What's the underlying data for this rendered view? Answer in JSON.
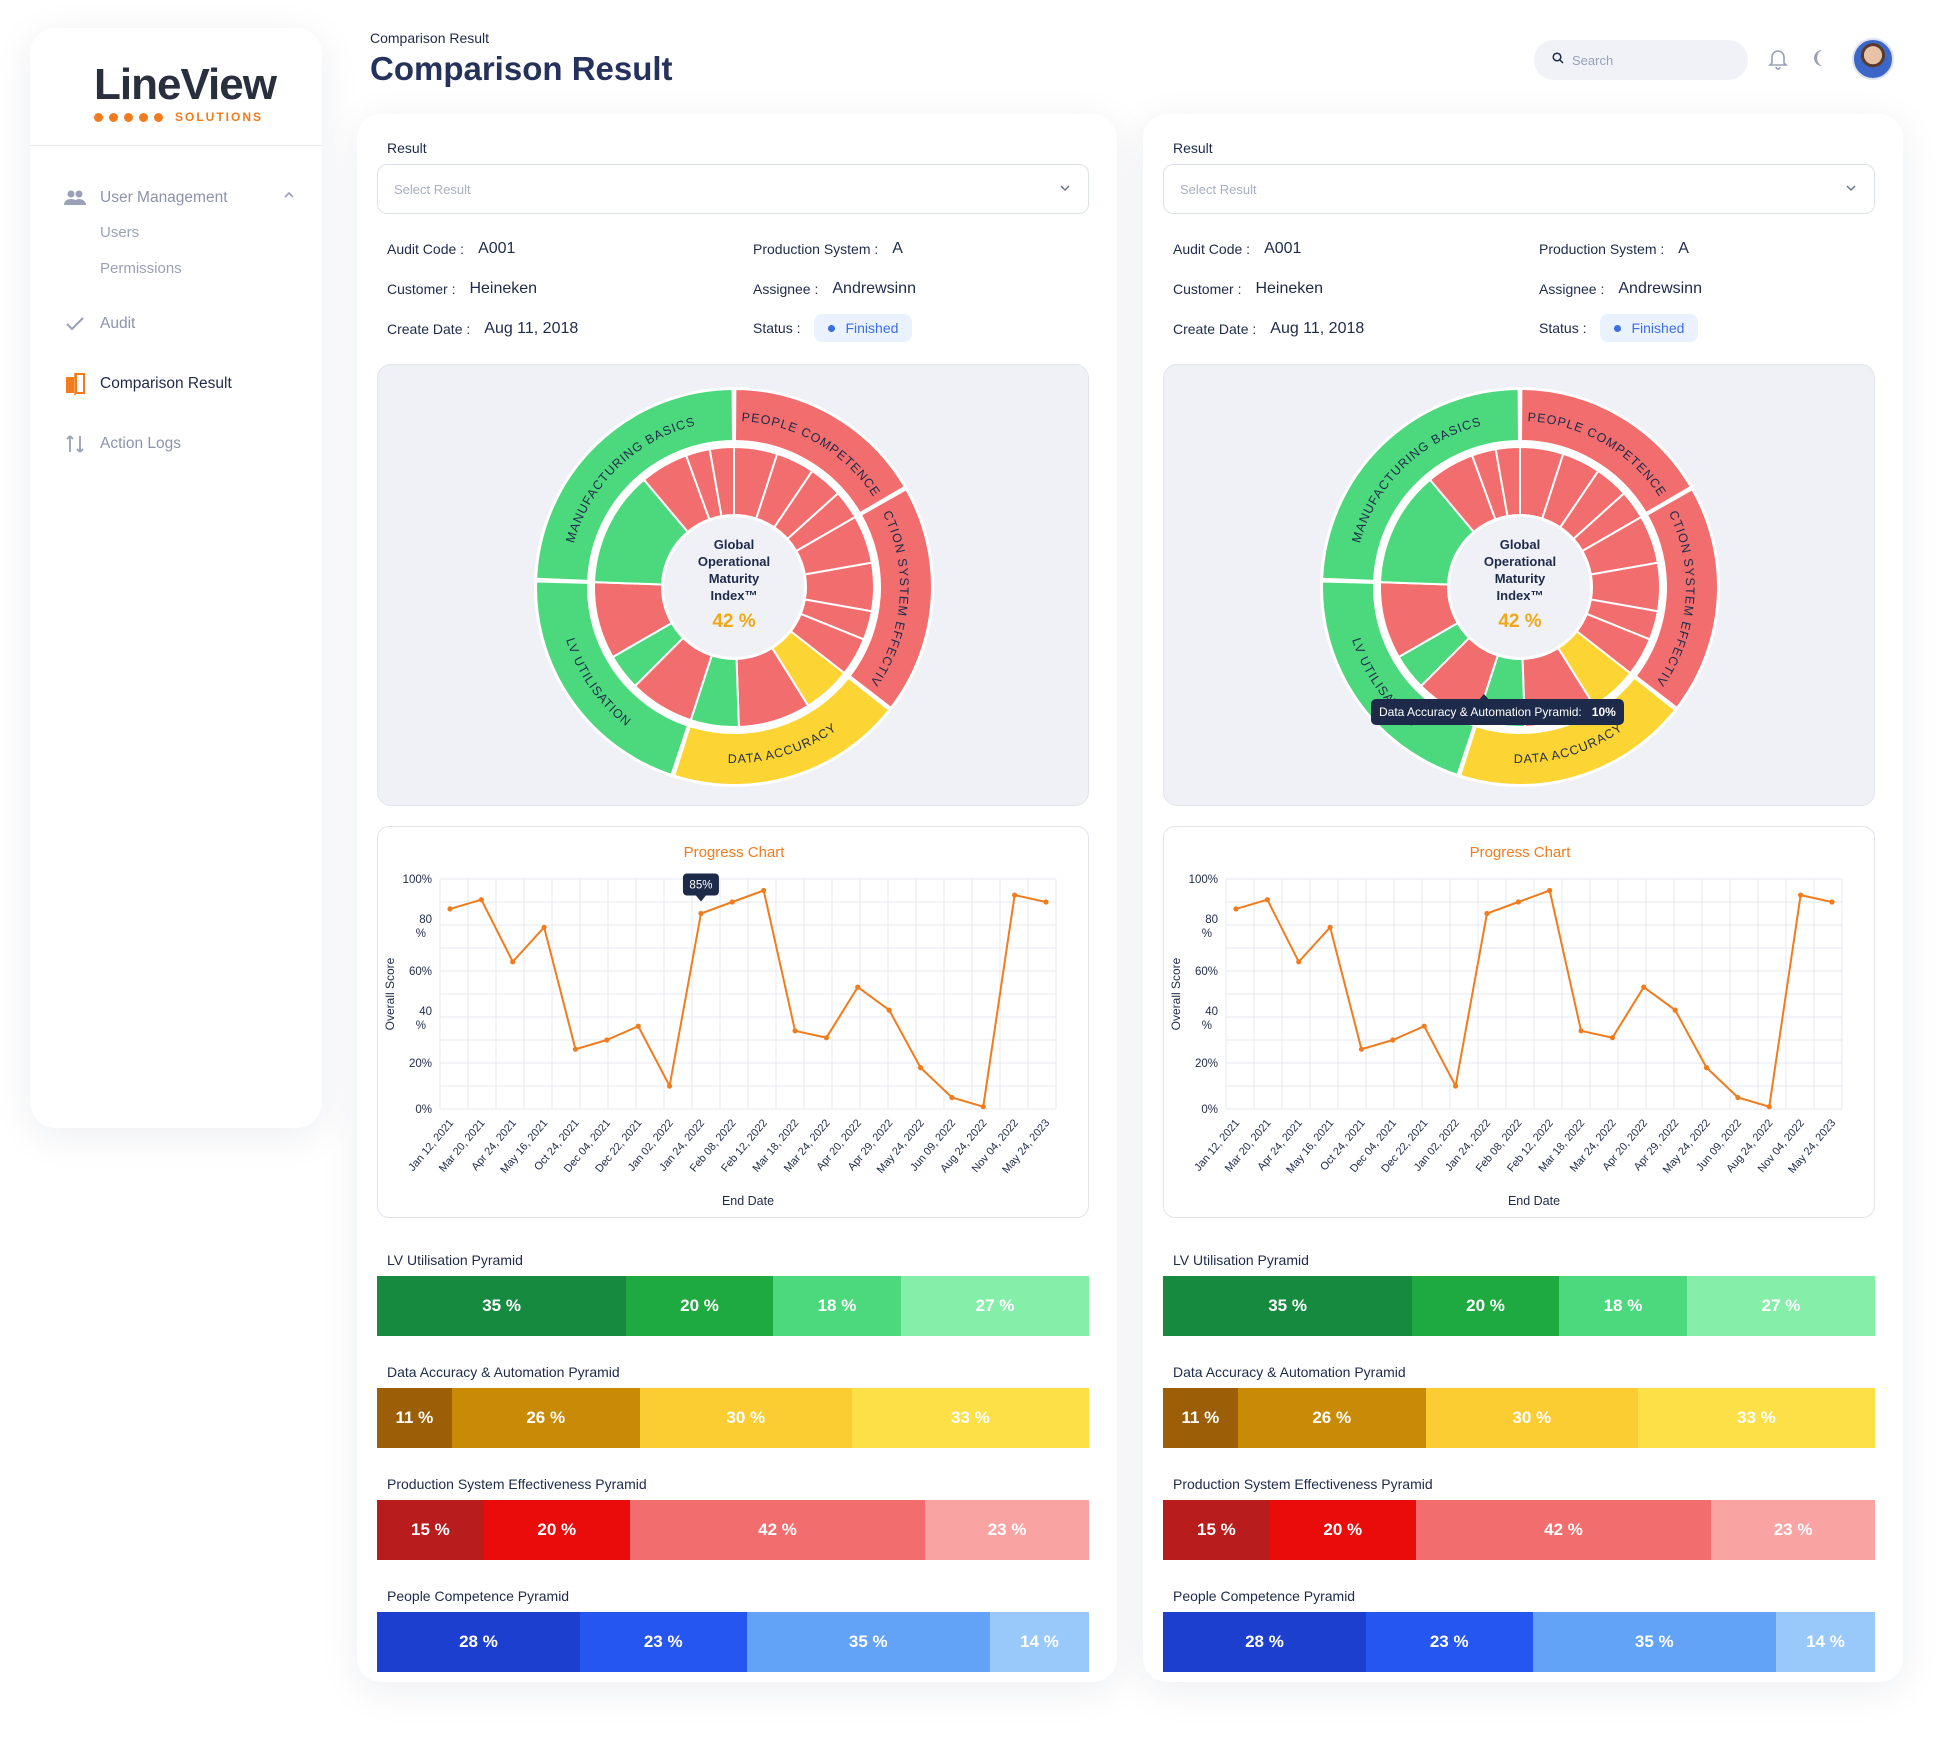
{
  "app": {
    "logo_word": "LineView",
    "logo_sub": "SOLUTIONS"
  },
  "sidebar": {
    "user_management": "User Management",
    "users": "Users",
    "permissions": "Permissions",
    "audit": "Audit",
    "comparison_result": "Comparison Result",
    "action_logs": "Action Logs"
  },
  "header": {
    "breadcrumb": "Comparison Result",
    "title": "Comparison Result",
    "search_placeholder": "Search"
  },
  "panels": [
    {
      "result_label": "Result",
      "select_placeholder": "Select Result",
      "audit_code_label": "Audit Code :",
      "audit_code": "A001",
      "production_system_label": "Production System :",
      "production_system": "A",
      "customer_label": "Customer :",
      "customer": "Heineken",
      "assignee_label": "Assignee :",
      "assignee": "Andrewsinn",
      "create_date_label": "Create Date :",
      "create_date": "Aug 11, 2018",
      "status_label": "Status :",
      "status": "Finished",
      "tooltip": null
    },
    {
      "result_label": "Result",
      "select_placeholder": "Select Result",
      "audit_code_label": "Audit Code :",
      "audit_code": "A001",
      "production_system_label": "Production System :",
      "production_system": "A",
      "customer_label": "Customer :",
      "customer": "Heineken",
      "assignee_label": "Assignee :",
      "assignee": "Andrewsinn",
      "create_date_label": "Create Date :",
      "create_date": "Aug 11, 2018",
      "status_label": "Status :",
      "status": "Finished",
      "tooltip": {
        "label": "Data Accuracy & Automation Pyramid:",
        "value": "10%"
      }
    }
  ],
  "sunburst": {
    "center_lines": [
      "Global",
      "Operational",
      "Maturity",
      "Index™"
    ],
    "center_value": "42 %",
    "outer": [
      {
        "name": "PEOPLE COMPETENCE",
        "color": "#f26d6d",
        "start": 0,
        "end": 60
      },
      {
        "name": "PRODUCTION SYSTEM EFFECTIVENESS",
        "color": "#f26d6d",
        "start": 60,
        "end": 128
      },
      {
        "name": "DATA ACCURACY",
        "color": "#fcd535",
        "start": 128,
        "end": 198
      },
      {
        "name": "LV UTILISATION",
        "color": "#4cd87c",
        "start": 198,
        "end": 272
      },
      {
        "name": "MANUFACTURING BASICS",
        "color": "#4cd87c",
        "start": 272,
        "end": 360
      }
    ],
    "inner": [
      {
        "color": "#f26d6d",
        "start": 0,
        "end": 18
      },
      {
        "color": "#f26d6d",
        "start": 18,
        "end": 34
      },
      {
        "color": "#f26d6d",
        "start": 34,
        "end": 48
      },
      {
        "color": "#f26d6d",
        "start": 48,
        "end": 60
      },
      {
        "color": "#f26d6d",
        "start": 60,
        "end": 80
      },
      {
        "color": "#f26d6d",
        "start": 80,
        "end": 100
      },
      {
        "color": "#f26d6d",
        "start": 100,
        "end": 112
      },
      {
        "color": "#f26d6d",
        "start": 112,
        "end": 128
      },
      {
        "color": "#fcd535",
        "start": 128,
        "end": 148
      },
      {
        "color": "#f26d6d",
        "start": 148,
        "end": 178
      },
      {
        "color": "#4cd87c",
        "start": 178,
        "end": 198
      },
      {
        "color": "#f26d6d",
        "start": 198,
        "end": 225
      },
      {
        "color": "#4cd87c",
        "start": 225,
        "end": 240
      },
      {
        "color": "#f26d6d",
        "start": 240,
        "end": 272
      },
      {
        "color": "#4cd87c",
        "start": 272,
        "end": 320
      },
      {
        "color": "#f26d6d",
        "start": 320,
        "end": 340
      },
      {
        "color": "#f26d6d",
        "start": 340,
        "end": 350
      },
      {
        "color": "#f26d6d",
        "start": 350,
        "end": 360
      }
    ]
  },
  "chart_data": {
    "type": "line",
    "title": "Progress Chart",
    "xlabel": "End Date",
    "ylabel": "Overall Score",
    "ylim": [
      0,
      100
    ],
    "y_ticks": [
      "0%",
      "20%",
      "40 %",
      "60%",
      "80 %",
      "100%"
    ],
    "categories": [
      "Jan 12, 2021",
      "Mar 20, 2021",
      "Apr 24, 2021",
      "May 16, 2021",
      "Oct 24, 2021",
      "Dec 04, 2021",
      "Dec 22, 2021",
      "Jan 02, 2022",
      "Jan 24, 2022",
      "Feb 08, 2022",
      "Feb 12, 2022",
      "Mar 18, 2022",
      "Mar 24, 2022",
      "Apr 20, 2022",
      "Apr 29, 2022",
      "May 24, 2022",
      "Jun 09, 2022",
      "Aug 24, 2022",
      "Nov 04, 2022",
      "May 24, 2023"
    ],
    "series": [
      {
        "values": [
          87,
          91,
          64,
          79,
          26,
          30,
          36,
          10,
          85,
          90,
          95,
          34,
          31,
          53,
          43,
          18,
          5,
          1,
          93,
          90
        ]
      }
    ],
    "callout": "85%",
    "callout_index": 8,
    "grid": true,
    "color": "#f07c1e"
  },
  "pyramids": [
    {
      "label": "LV Utilisation Pyramid",
      "segments": [
        {
          "text": "35 %",
          "pct": 35,
          "color": "#168a3e"
        },
        {
          "text": "20 %",
          "pct": 20.6,
          "color": "#1eaa40"
        },
        {
          "text": "18 %",
          "pct": 18,
          "color": "#4cd87c"
        },
        {
          "text": "27 %",
          "pct": 26.4,
          "color": "#85eea8"
        }
      ]
    },
    {
      "label": "Data Accuracy & Automation Pyramid",
      "segments": [
        {
          "text": "11 %",
          "pct": 10.5,
          "color": "#9c5e06"
        },
        {
          "text": "26 %",
          "pct": 26.4,
          "color": "#c98a05"
        },
        {
          "text": "30 %",
          "pct": 29.8,
          "color": "#fccc33"
        },
        {
          "text": "33 %",
          "pct": 33.3,
          "color": "#fde047"
        }
      ]
    },
    {
      "label": "Production System Effectiveness Pyramid",
      "segments": [
        {
          "text": "15 %",
          "pct": 15,
          "color": "#b81c1c"
        },
        {
          "text": "20 %",
          "pct": 20.5,
          "color": "#ea0b0b"
        },
        {
          "text": "42 %",
          "pct": 41.5,
          "color": "#f26d6d"
        },
        {
          "text": "23 %",
          "pct": 23,
          "color": "#f9a3a3"
        }
      ]
    },
    {
      "label": "People Competence Pyramid",
      "segments": [
        {
          "text": "28 %",
          "pct": 28.5,
          "color": "#1d3fd0"
        },
        {
          "text": "23 %",
          "pct": 23.4,
          "color": "#2656f0"
        },
        {
          "text": "35 %",
          "pct": 34.2,
          "color": "#62a3f7"
        },
        {
          "text": "14 %",
          "pct": 13.9,
          "color": "#99c9fb"
        }
      ]
    }
  ]
}
